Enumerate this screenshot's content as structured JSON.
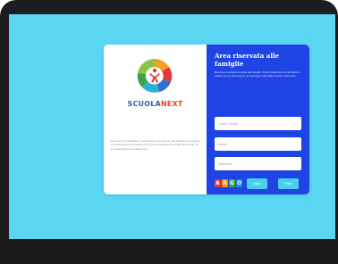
{
  "card": {
    "brand_part1": "SCUOLA",
    "brand_part2": "NEXT",
    "left_description": "Benvenuto in ScuolaNext, l'applicazione che consente alle famiglie di consultare comodamente le informazioni sul percorso scolastico dei propri figli. Accedi con le credenziali fornite dalla scuola.",
    "title": "Area riservata alle famiglie",
    "description": "Benvenuto nell'area riservata alle famiglie. Potrai visualizzare le informazioni relative ai voti, alle assenze, ai messaggi inviati dalla scuola e molto altro.",
    "fields": {
      "school_code_placeholder": "Codice Scuola",
      "username_placeholder": "Utente",
      "password_placeholder": "Password"
    },
    "argo_letters": [
      "A",
      "R",
      "G",
      "O"
    ],
    "argo_colors": [
      "#e53935",
      "#fb8c00",
      "#43a047",
      "#1e88e5"
    ],
    "help_button": "Aiuto",
    "login_button": "Entra"
  },
  "colors": {
    "screen_bg": "#5ad6f2",
    "panel_blue": "#1f44e6",
    "button_cyan": "#49d0f0",
    "brand_blue": "#2a64b5",
    "brand_red": "#e2452b"
  }
}
